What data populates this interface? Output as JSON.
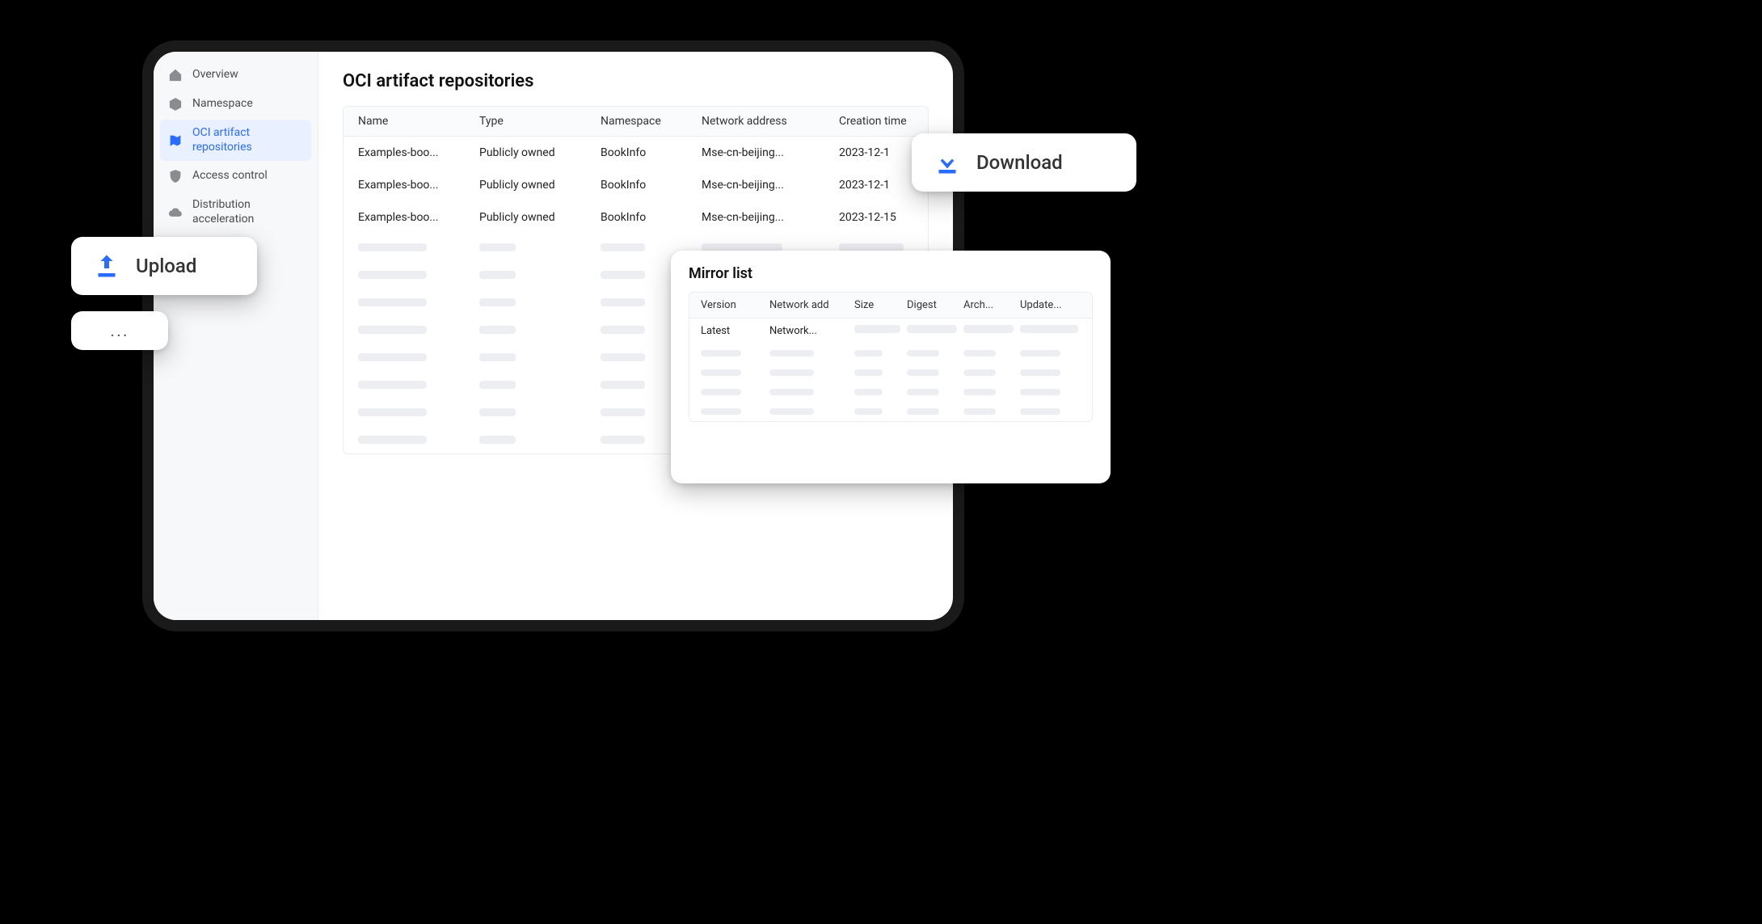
{
  "sidebar": {
    "items": [
      {
        "label": "Overview"
      },
      {
        "label": "Namespace"
      },
      {
        "label": "OCI artifact repositories"
      },
      {
        "label": "Access control"
      },
      {
        "label": "Distribution acceleration"
      }
    ]
  },
  "main": {
    "title": "OCI artifact repositories",
    "columns": {
      "name": "Name",
      "type": "Type",
      "namespace": "Namespace",
      "network": "Network address",
      "created": "Creation time"
    },
    "rows": [
      {
        "name": "Examples-boo...",
        "type": "Publicly owned",
        "namespace": "BookInfo",
        "network": "Mse-cn-beijing...",
        "created": "2023-12-1"
      },
      {
        "name": "Examples-boo...",
        "type": "Publicly owned",
        "namespace": "BookInfo",
        "network": "Mse-cn-beijing...",
        "created": "2023-12-1"
      },
      {
        "name": "Examples-boo...",
        "type": "Publicly owned",
        "namespace": "BookInfo",
        "network": "Mse-cn-beijing...",
        "created": "2023-12-15"
      }
    ]
  },
  "actions": {
    "upload": "Upload",
    "download": "Download",
    "more": "..."
  },
  "mirror": {
    "title": "Mirror list",
    "columns": {
      "version": "Version",
      "network": "Network add",
      "size": "Size",
      "digest": "Digest",
      "arch": "Arch...",
      "updated": "Update..."
    },
    "rows": [
      {
        "version": "Latest",
        "network": "Network..."
      }
    ]
  },
  "colors": {
    "accent": "#2a6cff"
  }
}
